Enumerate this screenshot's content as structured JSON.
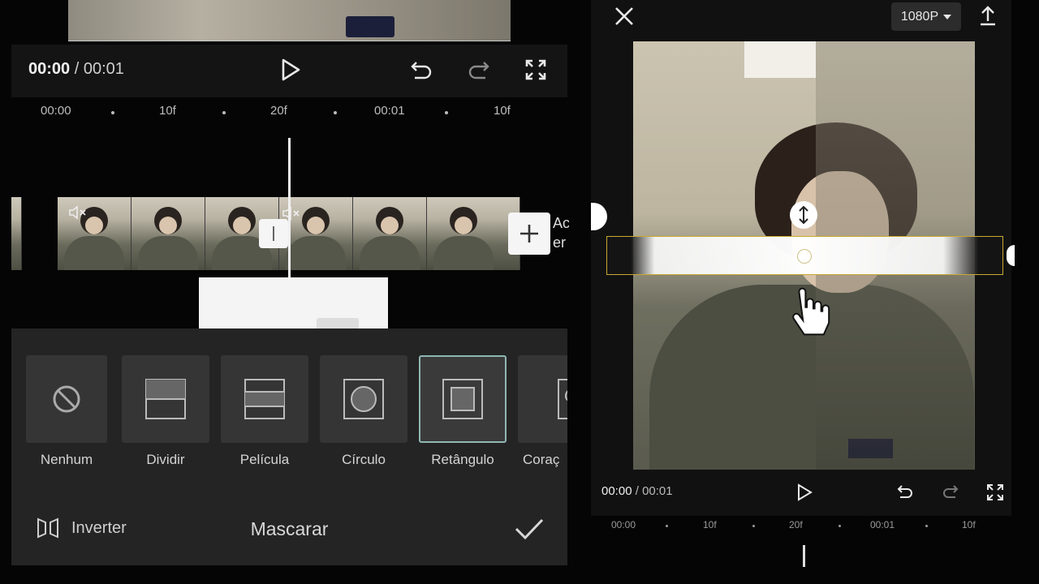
{
  "editor": {
    "current_time": "00:00",
    "separator": " / ",
    "total_time": "00:01",
    "ruler_ticks": [
      "00:00",
      "10f",
      "20f",
      "00:01",
      "10f"
    ],
    "add_clip_label": "Ac er"
  },
  "mask": {
    "options": [
      {
        "label": "Nenhum",
        "icon": "no-mask-icon"
      },
      {
        "label": "Dividir",
        "icon": "split-mask-icon"
      },
      {
        "label": "Película",
        "icon": "film-mask-icon"
      },
      {
        "label": "Círculo",
        "icon": "circle-mask-icon"
      },
      {
        "label": "Retângulo",
        "icon": "rectangle-mask-icon",
        "selected": true
      },
      {
        "label": "Coraç",
        "icon": "heart-mask-icon"
      }
    ],
    "invert_label": "Inverter",
    "title": "Mascarar"
  },
  "preview": {
    "resolution": "1080P",
    "current_time": "00:00",
    "separator": " / ",
    "total_time": "00:01",
    "ruler_ticks": [
      "00:00",
      "10f",
      "20f",
      "00:01",
      "10f"
    ]
  },
  "colors": {
    "mask_border": "#c8a934",
    "selected_option_border": "#8fb7b3",
    "panel_bg": "#242424"
  }
}
